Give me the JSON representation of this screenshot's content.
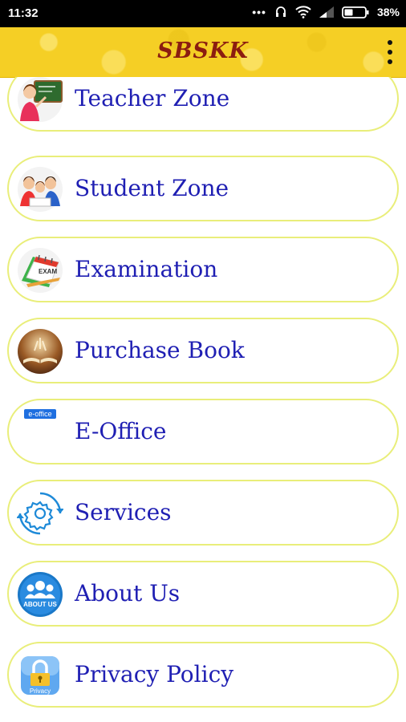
{
  "status_bar": {
    "time": "11:32",
    "battery_percent": "38%"
  },
  "app_bar": {
    "title": "SBSKK",
    "menu_icon": "more-vert-icon"
  },
  "menu": {
    "items": [
      {
        "label": "Teacher Zone",
        "icon": "teacher-icon"
      },
      {
        "label": "Student Zone",
        "icon": "students-icon"
      },
      {
        "label": "Examination",
        "icon": "exam-calendar-icon"
      },
      {
        "label": "Purchase Book",
        "icon": "book-icon"
      },
      {
        "label": "E-Office",
        "icon": "e-office-icon",
        "icon_text": "e-office"
      },
      {
        "label": "Services",
        "icon": "services-gear-icon"
      },
      {
        "label": "About Us",
        "icon": "about-us-icon",
        "icon_text": "ABOUT US"
      },
      {
        "label": "Privacy Policy",
        "icon": "privacy-lock-icon",
        "icon_text": "Privacy"
      }
    ]
  },
  "colors": {
    "app_bar_bg": "#f5cf25",
    "title_color": "#8b1d10",
    "label_color": "#1f1fb3",
    "item_border": "#e9ee7a"
  }
}
